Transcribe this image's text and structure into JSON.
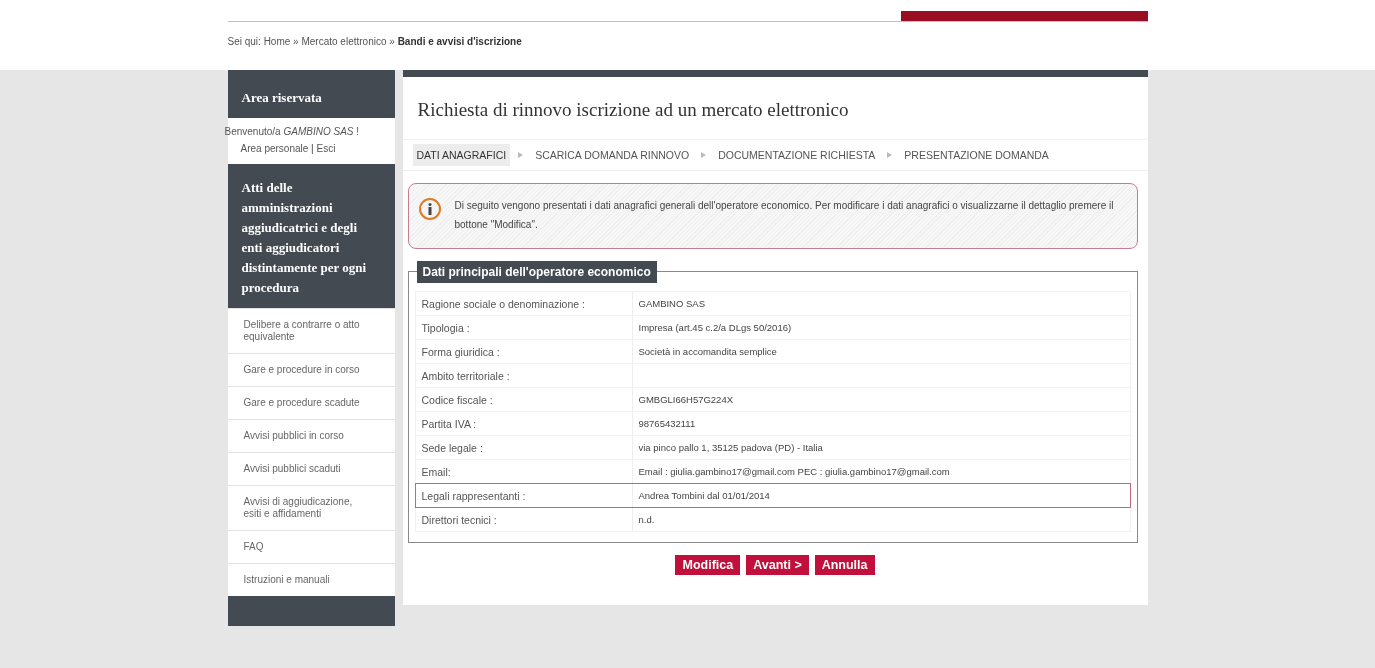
{
  "breadcrumb": {
    "prefix": "Sei qui:",
    "links": [
      "Home",
      "Mercato elettronico"
    ],
    "separator": "»",
    "current": "Bandi e avvisi d'iscrizione"
  },
  "sidebar": {
    "login_title": "Area riservata",
    "welcome": "Benvenuto/a",
    "user": "GAMBINO SAS",
    "welcome_end": "!",
    "links": [
      "Area personale",
      "Esci"
    ],
    "link_separator": "|",
    "section_title": "Atti delle amministrazioni aggiudicatrici e degli enti aggiudicatori distintamente per ogni procedura",
    "items": [
      {
        "label": "Delibere a contrarre o atto equivalente"
      },
      {
        "label": "Gare e procedure in corso"
      },
      {
        "label": "Gare e procedure scadute"
      },
      {
        "label": "Avvisi pubblici in corso"
      },
      {
        "label": "Avvisi pubblici scaduti"
      },
      {
        "label": "Avvisi di aggiudicazione, esiti e affidamenti"
      },
      {
        "label": "FAQ"
      },
      {
        "label": "Istruzioni e manuali"
      }
    ]
  },
  "page_title": "Richiesta di rinnovo iscrizione ad un mercato elettronico",
  "steps": [
    {
      "label": "DATI ANAGRAFICI",
      "selected": true
    },
    {
      "label": "SCARICA DOMANDA RINNOVO",
      "selected": false
    },
    {
      "label": "DOCUMENTAZIONE RICHIESTA",
      "selected": false
    },
    {
      "label": "PRESENTAZIONE DOMANDA",
      "selected": false
    }
  ],
  "info_message": "Di seguito vengono presentati i dati anagrafici generali dell'operatore economico. Per modificare i dati anagrafici o visualizzarne il dettaglio premere il bottone \"Modifica\".",
  "fieldset": {
    "legend": "Dati principali dell'operatore economico",
    "rows": [
      {
        "label": "Ragione sociale o denominazione :",
        "value": "GAMBINO SAS",
        "highlighted": false
      },
      {
        "label": "Tipologia :",
        "value": "Impresa (art.45 c.2/a DLgs 50/2016)",
        "highlighted": false
      },
      {
        "label": "Forma giuridica :",
        "value": "Società in accomandita semplice",
        "highlighted": false
      },
      {
        "label": "Ambito territoriale :",
        "highlighted": false
      },
      {
        "label": "Codice fiscale :",
        "value": "GMBGLI66H57G224X",
        "highlighted": false
      },
      {
        "label": "Partita IVA :",
        "value": "98765432111",
        "highlighted": false
      },
      {
        "label": "Sede legale :",
        "value": "via pinco pallo 1, 35125 padova (PD) - Italia",
        "highlighted": false
      },
      {
        "label": "Email:",
        "value": "Email : giulia.gambino17@gmail.com PEC : giulia.gambino17@gmail.com",
        "highlighted": false
      },
      {
        "label": "Legali rappresentanti :",
        "value": "Andrea Tombini dal 01/01/2014",
        "highlighted": true
      },
      {
        "label": "Direttori tecnici :",
        "value": "n.d.",
        "highlighted": false
      }
    ]
  },
  "buttons": [
    "Modifica",
    "Avanti >",
    "Annulla"
  ]
}
